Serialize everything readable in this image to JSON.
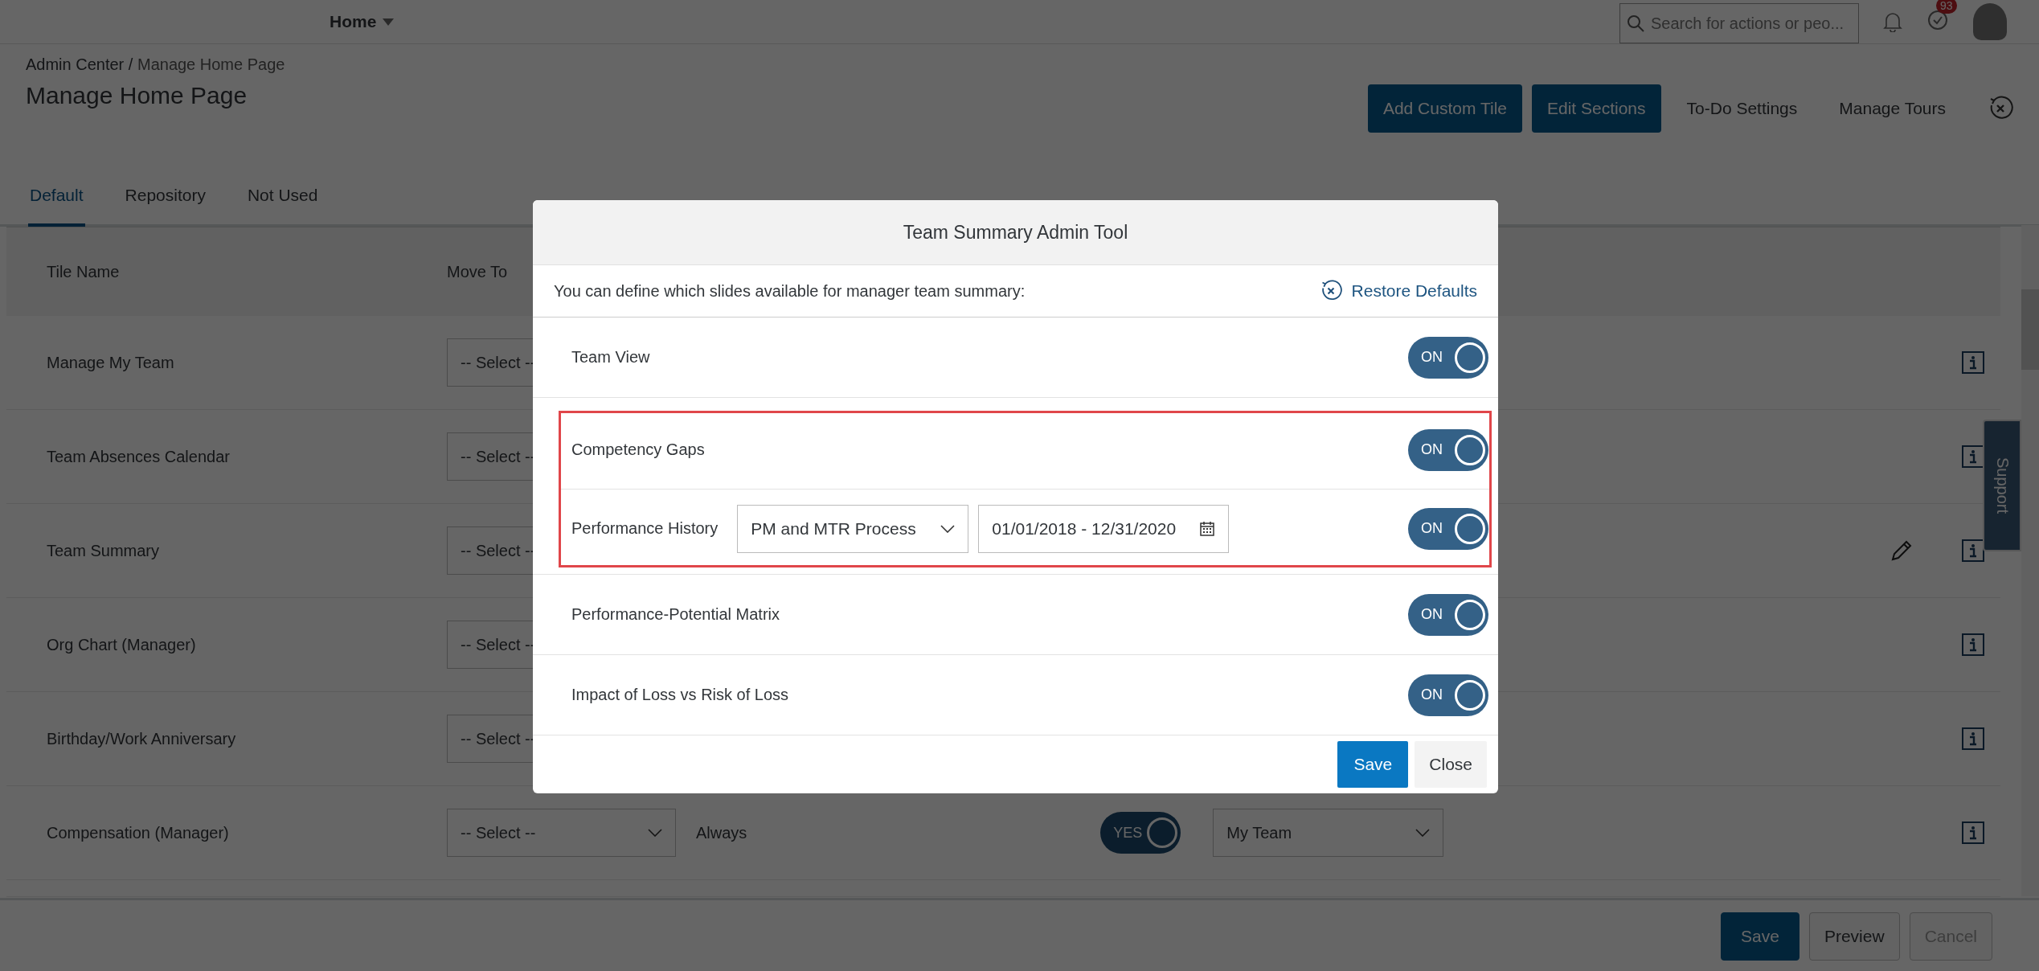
{
  "top_bar": {
    "menu": "Home",
    "search": {
      "placeholder": "Search for actions or peo..."
    },
    "badge": "93"
  },
  "breadcrumb": {
    "parent": "Admin Center",
    "separator": "/",
    "current": "Manage Home Page"
  },
  "page_title": "Manage Home Page",
  "actions": [
    {
      "label": "Add Custom Tile",
      "kind": "primary"
    },
    {
      "label": "Edit Sections",
      "kind": "primary"
    },
    {
      "label": "To-Do Settings",
      "kind": "link"
    },
    {
      "label": "Manage Tours",
      "kind": "link"
    }
  ],
  "tabs": [
    {
      "label": "Default",
      "selected": true
    },
    {
      "label": "Repository",
      "selected": false
    },
    {
      "label": "Not Used",
      "selected": false
    }
  ],
  "table": {
    "columns": [
      "Tile Name",
      "Move To"
    ],
    "rows": [
      {
        "name": "Manage My Team",
        "move_to": "-- Select --",
        "editable": false
      },
      {
        "name": "Team Absences Calendar",
        "move_to": "-- Select --",
        "editable": false
      },
      {
        "name": "Team Summary",
        "move_to": "-- Select --",
        "editable": true
      },
      {
        "name": "Org Chart (Manager)",
        "move_to": "-- Select --",
        "editable": false
      },
      {
        "name": "Birthday/Work Anniversary",
        "move_to": "-- Select --",
        "editable": false
      },
      {
        "name": "Compensation (Manager)",
        "move_to": "-- Select --",
        "visibility": "Always",
        "toggle": {
          "label": "YES",
          "on": true
        },
        "audience": "My Team",
        "editable": false
      }
    ]
  },
  "support_tab": "Support",
  "footer_buttons": [
    {
      "label": "Save",
      "kind": "primary",
      "disabled": false
    },
    {
      "label": "Preview",
      "kind": "secondary",
      "disabled": false
    },
    {
      "label": "Cancel",
      "kind": "secondary",
      "disabled": true
    }
  ],
  "dialog": {
    "title": "Team Summary Admin Tool",
    "intro": "You can define which slides available for manager team summary:",
    "restore": "Restore Defaults",
    "rows": [
      {
        "label": "Team View",
        "kind": "toggle",
        "highlighted": false,
        "toggle": {
          "label": "ON",
          "on": true
        }
      },
      {
        "label": "Competency Gaps",
        "kind": "toggle",
        "highlighted": true,
        "toggle": {
          "label": "ON",
          "on": true
        }
      },
      {
        "label": "Performance History",
        "kind": "filtered",
        "highlighted": true,
        "process": "PM and MTR Process",
        "date_range": "01/01/2018 - 12/31/2020",
        "toggle": {
          "label": "ON",
          "on": true
        }
      },
      {
        "label": "Performance-Potential Matrix",
        "kind": "toggle",
        "highlighted": false,
        "toggle": {
          "label": "ON",
          "on": true
        }
      },
      {
        "label": "Impact of Loss vs Risk of Loss",
        "kind": "toggle",
        "highlighted": false,
        "toggle": {
          "label": "ON",
          "on": true
        }
      }
    ],
    "buttons": [
      {
        "label": "Save",
        "kind": "primary"
      },
      {
        "label": "Close",
        "kind": "secondary"
      }
    ]
  }
}
